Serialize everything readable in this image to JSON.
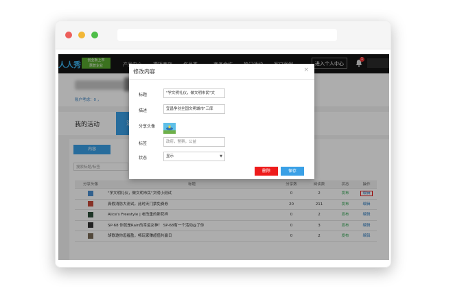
{
  "site": {
    "logo_text": "人人秀",
    "slogan": "创业板上市\n惠普企业",
    "nav": [
      "产品中心",
      "模板商店",
      "作品秀",
      "商务合作",
      "热门活动",
      "客户案例"
    ],
    "enter_center": "进入个人中心",
    "notification_count": "1"
  },
  "user": {
    "stats": "账户考虑：0 ，"
  },
  "tabs": {
    "my_activity": "我的活动",
    "active_tab": "活"
  },
  "content": {
    "subtab": "内容",
    "search_placeholder": "搜索标题/标签"
  },
  "table": {
    "headers": {
      "image": "分享头像",
      "title": "标题",
      "share": "分享数",
      "read": "阅读数",
      "status": "状态",
      "op": "操作"
    },
    "rows": [
      {
        "title": "\"学文明礼仪，做文明市民\"文明小测试",
        "share": "0",
        "read": "2",
        "status": "发布",
        "op": "编辑",
        "thumb_color": "#4a8fd2"
      },
      {
        "title": "真假消防大测试，此时天门票免费券",
        "share": "20",
        "read": "211",
        "status": "发布",
        "op": "编辑",
        "thumb_color": "#c84a3a"
      },
      {
        "title": "Alice's Freestyle | 老改重的新花样",
        "share": "0",
        "read": "2",
        "status": "发布",
        "op": "编辑",
        "thumb_color": "#2f4f3a"
      },
      {
        "title": "SP-68 你就是Rain的幸运女神！ SP-68有一个活动@了你",
        "share": "0",
        "read": "3",
        "status": "发布",
        "op": "编辑",
        "thumb_color": "#333333"
      },
      {
        "title": "胡歌邀你逛福盈，畅玩家赚超值共赢日",
        "share": "0",
        "read": "2",
        "status": "发布",
        "op": "编辑",
        "thumb_color": "#7a6a58"
      }
    ]
  },
  "modal": {
    "title": "修改内容",
    "close": "×",
    "fields": {
      "title_label": "标题",
      "title_value": "\"学文明礼仪，做文明市民\"文",
      "desc_label": "描述",
      "desc_value": "宜昌争创全国文明城市\"三库",
      "avatar_label": "分享头像",
      "tags_label": "标签",
      "tags_placeholder": "政府，警察，公益",
      "status_label": "状态",
      "status_value": "显示"
    },
    "delete_button": "删除",
    "save_button": "保存"
  },
  "colors": {
    "accent": "#3aa0e6",
    "danger": "#ee1c1c",
    "nav_bg": "#161616",
    "published": "#2ea44f"
  }
}
